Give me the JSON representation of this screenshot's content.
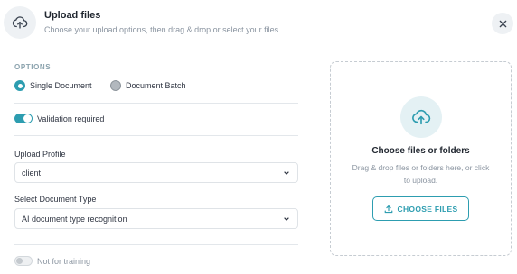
{
  "header": {
    "title": "Upload files",
    "subtitle": "Choose your upload options, then drag & drop or select your files.",
    "icon": "cloud-upload-icon",
    "close_icon": "close-icon"
  },
  "options": {
    "heading": "OPTIONS",
    "mode": {
      "selected": "Single Document",
      "choices": [
        {
          "label": "Single Document",
          "selected": true
        },
        {
          "label": "Document Batch",
          "selected": false
        }
      ]
    },
    "validation": {
      "label": "Validation required",
      "enabled": true
    },
    "upload_profile": {
      "label": "Upload Profile",
      "value": "client"
    },
    "document_type": {
      "label": "Select Document Type",
      "value": "AI document type recognition"
    },
    "not_for_training": {
      "label": "Not for training",
      "enabled": false
    }
  },
  "dropzone": {
    "title": "Choose files or folders",
    "description": "Drag & drop files or folders here, or click to upload.",
    "button_label": "CHOOSE FILES",
    "icon": "cloud-upload-icon",
    "button_icon": "upload-icon"
  },
  "colors": {
    "accent": "#2d9db0",
    "muted_text": "#8a94a0",
    "border": "#dfe3e7"
  }
}
